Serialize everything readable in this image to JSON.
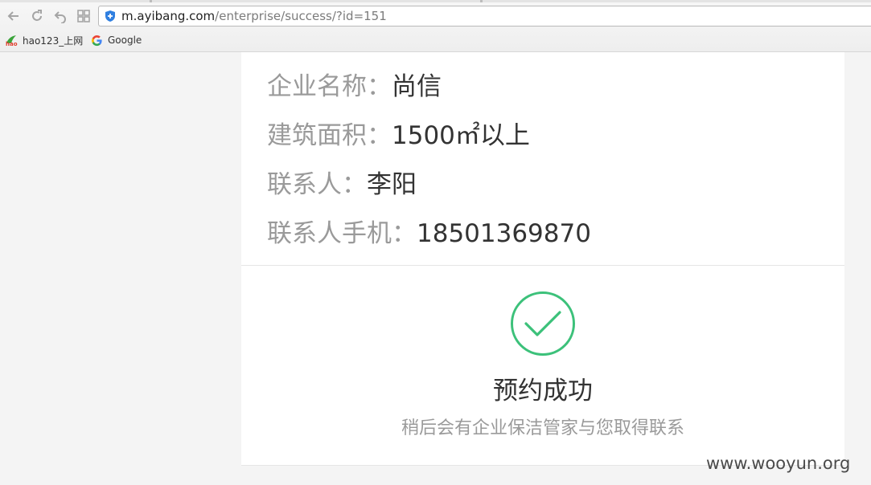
{
  "browser": {
    "url_host": "m.ayibang.com",
    "url_path": "/enterprise/success/?id=151",
    "bookmarks": [
      {
        "label": "hao123_上网",
        "icon": "hao123-icon"
      },
      {
        "label": "Google",
        "icon": "google-icon"
      }
    ],
    "nav_icons": [
      "back-icon",
      "refresh-icon",
      "undo-icon",
      "grid-icon"
    ]
  },
  "booking": {
    "fields": [
      {
        "label": "企业名称：",
        "value": "尚信"
      },
      {
        "label": "建筑面积：",
        "value": "1500㎡以上"
      },
      {
        "label": "联系人：",
        "value": "李阳"
      },
      {
        "label": "联系人手机：",
        "value": "18501369870"
      }
    ]
  },
  "status": {
    "icon": "check-circle-icon",
    "title": "预约成功",
    "subtitle": "稍后会有企业保洁管家与您取得联系",
    "accent_color": "#3cc17a"
  },
  "watermark": "www.wooyun.org"
}
